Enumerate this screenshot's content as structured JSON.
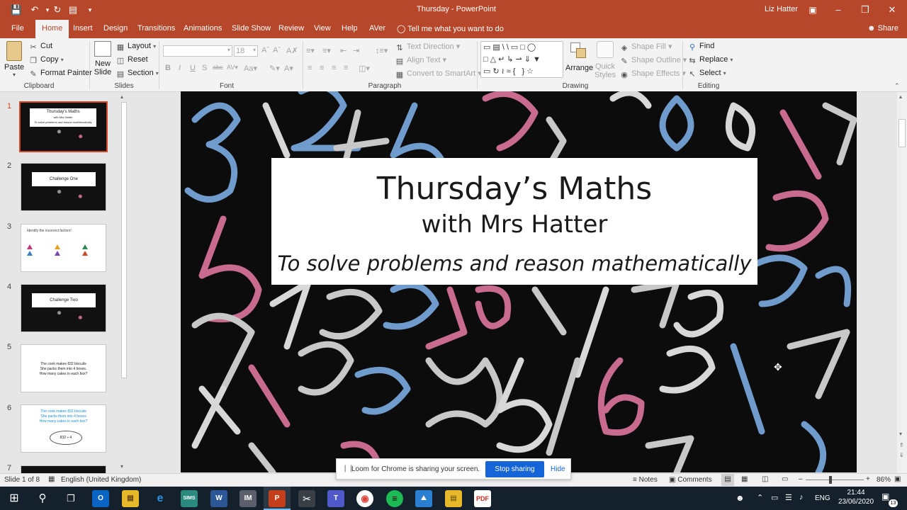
{
  "app": {
    "doc_title": "Thursday",
    "separator": "-",
    "app_name": "PowerPoint",
    "user": "Liz Hatter",
    "share": "Share"
  },
  "tabs": [
    "File",
    "Home",
    "Insert",
    "Design",
    "Transitions",
    "Animations",
    "Slide Show",
    "Review",
    "View",
    "Help",
    "AVer"
  ],
  "tell_me": "Tell me what you want to do",
  "ribbon": {
    "clipboard": {
      "group": "Clipboard",
      "paste": "Paste",
      "cut": "Cut",
      "copy": "Copy",
      "format_painter": "Format Painter"
    },
    "slides": {
      "group": "Slides",
      "new_slide_1": "New",
      "new_slide_2": "Slide",
      "layout": "Layout",
      "reset": "Reset",
      "section": "Section"
    },
    "font": {
      "group": "Font",
      "size": "18"
    },
    "paragraph": {
      "group": "Paragraph",
      "text_direction": "Text Direction",
      "align_text": "Align Text",
      "smartart": "Convert to SmartArt"
    },
    "drawing": {
      "group": "Drawing",
      "arrange": "Arrange",
      "quick_styles_1": "Quick",
      "quick_styles_2": "Styles",
      "shape_fill": "Shape Fill",
      "shape_outline": "Shape Outline",
      "shape_effects": "Shape Effects"
    },
    "editing": {
      "group": "Editing",
      "find": "Find",
      "replace": "Replace",
      "select": "Select"
    }
  },
  "thumbnails": [
    {
      "num": "1",
      "title": "Thursday's Maths",
      "sub": "with Mrs Hatter",
      "sub2": "To solve problems and reason mathematically"
    },
    {
      "num": "2",
      "title": "Challenge One"
    },
    {
      "num": "3",
      "title": "Identify the incorrect factors!"
    },
    {
      "num": "4",
      "title": "Challenge Two"
    },
    {
      "num": "5",
      "line1": "The cook makes 832 biscuits",
      "line2": "She packs them into 4 boxes.",
      "line3": "How many cakes in each box?"
    },
    {
      "num": "6",
      "line1": "The cook makes 832 biscuits",
      "line2": "She packs them into 4 boxes",
      "line3": "How many cakes in each box?",
      "cloud": "832 ÷ 4"
    },
    {
      "num": "7"
    }
  ],
  "slide": {
    "title": "Thursday’s Maths",
    "subtitle": "with Mrs Hatter",
    "objective": "To solve problems and reason mathematically"
  },
  "status": {
    "slide_of": "Slide 1 of 8",
    "language": "English (United Kingdom)",
    "notes": "Notes",
    "comments": "Comments",
    "zoom": "86%"
  },
  "loom": {
    "message": "Loom for Chrome is sharing your screen.",
    "stop": "Stop sharing",
    "hide": "Hide"
  },
  "taskbar": {
    "time": "21:44",
    "date": "23/06/2020",
    "lang": "ENG",
    "notif_count": "13"
  }
}
